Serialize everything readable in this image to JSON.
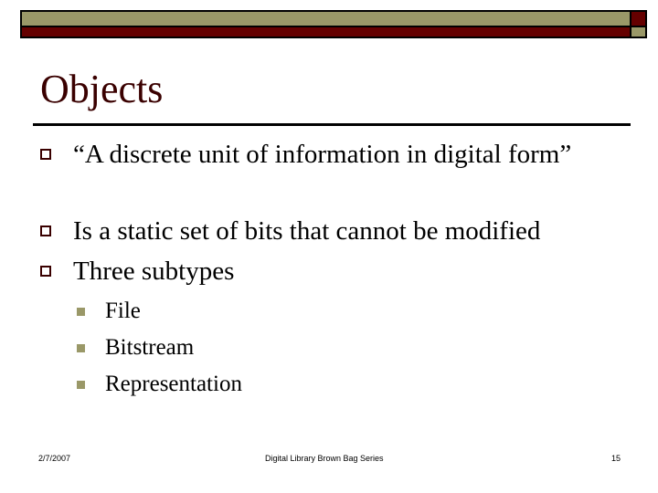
{
  "slide": {
    "title": "Objects",
    "bullets": [
      "“A discrete unit of information in digital form”",
      "Is a static set of bits that cannot be modified",
      "Three subtypes"
    ],
    "subbullets": [
      "File",
      "Bitstream",
      "Representation"
    ]
  },
  "footer": {
    "date": "2/7/2007",
    "center": "Digital Library Brown Bag Series",
    "page_number": "15"
  },
  "theme": {
    "olive": "#9a9868",
    "maroon": "#650000",
    "title_color": "#3a0000"
  }
}
